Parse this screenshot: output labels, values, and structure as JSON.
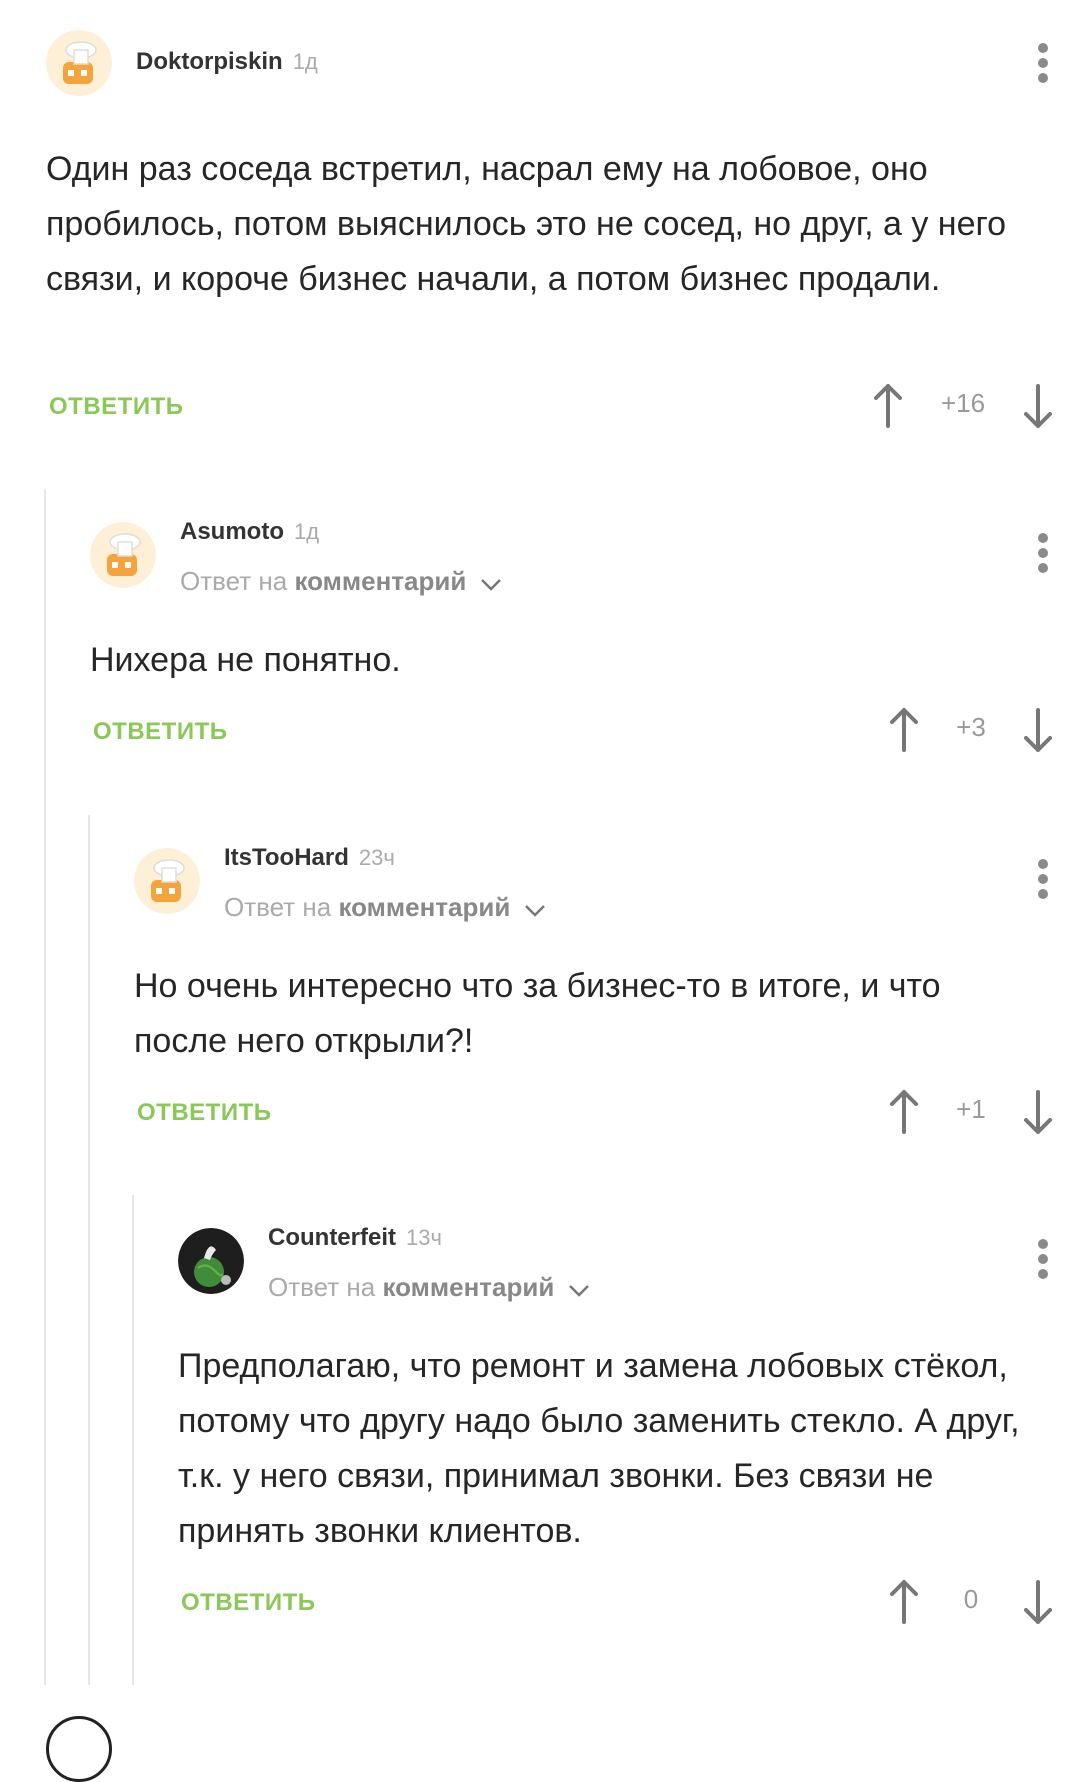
{
  "comments": [
    {
      "author": "Doktorpiskin",
      "time": "1д",
      "text": "Один раз соседа встретил, насрал ему на лобовое, оно пробилось, потом выяснилось это не сосед, но друг, а у него связи, и короче бизнес начали, а потом бизнес продали.",
      "reply_label": "ОТВЕТИТЬ",
      "score": "+16"
    },
    {
      "author": "Asumoto",
      "time": "1д",
      "reply_to_prefix": "Ответ на",
      "reply_to_link": "комментарий",
      "text": "Нихера не понятно.",
      "reply_label": "ОТВЕТИТЬ",
      "score": "+3"
    },
    {
      "author": "ItsTooHard",
      "time": "23ч",
      "reply_to_prefix": "Ответ на",
      "reply_to_link": "комментарий",
      "text": "Но очень интересно что за бизнес-то в итоге, и что после него открыли?!",
      "reply_label": "ОТВЕТИТЬ",
      "score": "+1"
    },
    {
      "author": "Counterfeit",
      "time": "13ч",
      "reply_to_prefix": "Ответ на",
      "reply_to_link": "комментарий",
      "text": "Предполагаю, что ремонт и замена лобовых стёкол, потому что другу надо было заменить стекло. А друг, т.к. у него связи, принимал звонки. Без связи не принять звонки клиентов.",
      "reply_label": "ОТВЕТИТЬ",
      "score": "0"
    }
  ],
  "icons": {
    "menu": "more-vertical-icon",
    "upvote": "arrow-up-icon",
    "downvote": "arrow-down-icon",
    "expand": "chevron-down-icon",
    "avatar_default": "default-avatar-icon"
  },
  "colors": {
    "accent_green": "#8ac858",
    "thread_line": "#e6e6e6",
    "muted_text": "#aaaaaa",
    "avatar_bg": "#fdf0d6"
  }
}
